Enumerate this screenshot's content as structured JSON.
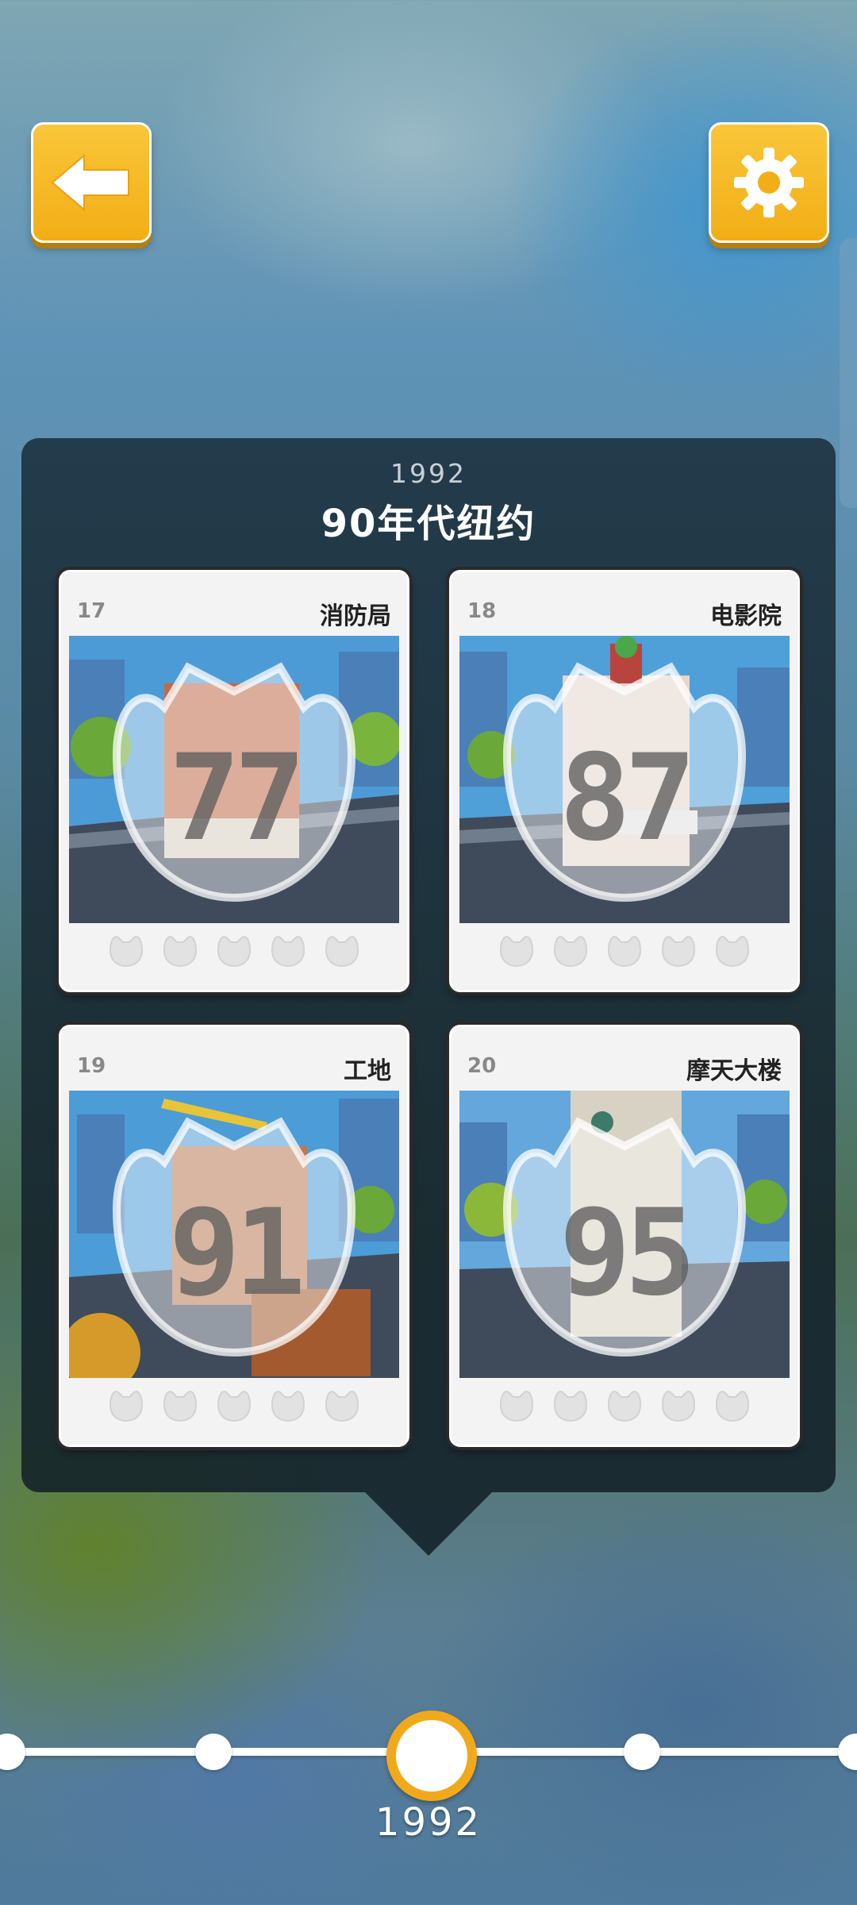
{
  "header": {
    "back_icon": "arrow-left-icon",
    "settings_icon": "gear-icon",
    "accent_color": "#f2ae16"
  },
  "era": {
    "year": "1992",
    "title": "90年代纽约"
  },
  "levels": [
    {
      "number": "17",
      "name": "消防局",
      "score": "77",
      "cats_earned": 0,
      "cats_total": 5
    },
    {
      "number": "18",
      "name": "电影院",
      "score": "87",
      "cats_earned": 0,
      "cats_total": 5
    },
    {
      "number": "19",
      "name": "工地",
      "score": "91",
      "cats_earned": 0,
      "cats_total": 5
    },
    {
      "number": "20",
      "name": "摩天大楼",
      "score": "95",
      "cats_earned": 0,
      "cats_total": 5
    }
  ],
  "timeline": {
    "current_year": "1992",
    "current_color": "#f1a91c"
  }
}
